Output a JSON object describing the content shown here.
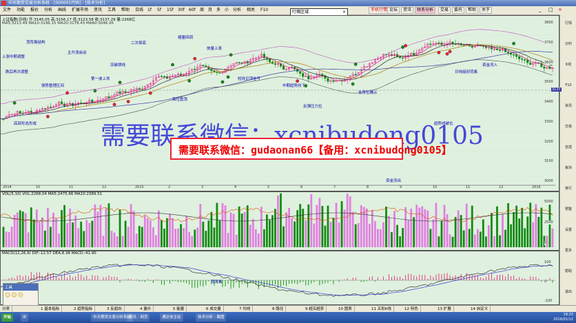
{
  "window": {
    "title": "中天期货交易分析系统 - [000001代码] - [技术分析]"
  },
  "menu": {
    "items": [
      "文件",
      "功能",
      "报价",
      "分析",
      "画线",
      "扩展市场",
      "资讯",
      "工具",
      "帮助"
    ],
    "popup": "叮嘱区域",
    "toolbar_tabs": [
      "日线",
      "1f",
      "5f",
      "15f",
      "30f",
      "60f",
      "周",
      "月",
      "多",
      "小",
      "分析",
      "相关",
      "F10"
    ],
    "right_buttons": [
      {
        "label": "手机行情",
        "red": true
      },
      {
        "label": "论坛",
        "red": false
      },
      {
        "label": "资讯",
        "red": false
      },
      {
        "label": "财务分析",
        "red": false,
        "highlight": true
      },
      {
        "label": "交易",
        "red": false
      },
      {
        "label": "委托",
        "red": false
      },
      {
        "label": "帮助",
        "red": false
      },
      {
        "label": "关于",
        "red": false
      }
    ]
  },
  "main_chart": {
    "header": "上证指数(日线) 开:3145.05 高:3156.17 低:3123.58 收:3137.29 量:2268亿",
    "header2": "MA5:3213.49 MA10:3196.15 MA20:3178.43 MA60:3046.95",
    "right_axis": [
      "3800",
      "3700",
      "3600",
      "3500",
      "3400",
      "3300",
      "3200",
      "3100",
      "3000"
    ],
    "x_labels": [
      "2014",
      "10",
      "11",
      "12",
      "2015",
      "2",
      "3",
      "4",
      "5",
      "6",
      "7",
      "8",
      "9",
      "10",
      "11",
      "12",
      "2016"
    ],
    "price_tag": "3137"
  },
  "annotations": [
    "上涨中期调整",
    "跌后再次调整",
    "顶背离结构",
    "主升浪启动",
    "强势整理区间",
    "第一波上攻",
    "二次探底",
    "突破颈线",
    "缩量回调",
    "放量上涨",
    "高位震荡",
    "短线见顶信号",
    "中期趋势向下",
    "反弹压力位",
    "支撑位确认",
    "趋势线破位",
    "日线级别背离",
    "资金流入",
    "资金流出",
    "底部形态形成"
  ],
  "volume_pane": {
    "label": "VOL(5,10) VOL:2268.04 MA5:2475.66 MA10:2389.51",
    "right_axis": [
      "5000",
      "2500",
      "0"
    ]
  },
  "macd_pane": {
    "label": "MACD(12,26,9) DIF:-12.57 DEA:8.38 MACD:-41.90",
    "right_axis": [
      "100",
      "0",
      "-100"
    ],
    "note": "顶背离"
  },
  "watermark": {
    "big": "需要联系微信：xcnibudong0105",
    "box": "需要联系微信：gudaonan66【备用：xcnibudong0105】"
  },
  "sidebar": [
    "行情",
    "分时",
    "K线",
    "F10",
    "资讯",
    "交易",
    "自选",
    "板块",
    "排行",
    "预警",
    "设置",
    "更多",
    "帮助",
    "退出"
  ],
  "tabs": [
    "分类",
    "1 基本指标",
    "2 趋势指标",
    "3 反趋向",
    "4 量价",
    "5 能量",
    "6 成交量",
    "7 均线",
    "8 路径",
    "9 超买超卖",
    "10 图表",
    "11 五彩K线",
    "12 特色",
    "13 扩展",
    "14 自定义"
  ],
  "mini_panel": {
    "title": "工具"
  },
  "taskbar": {
    "tasks": [
      "开始",
      "IE",
      "中天期货交易分析系统",
      "资讯 - 网页",
      "通达信主站",
      "技术分析 - 截图"
    ],
    "clock": "19:23",
    "date": "2016/01/12"
  },
  "colors": {
    "chart_bg": "#dff0df",
    "up": "#e0208a",
    "down": "#138a13",
    "ma": "#3a3aa0",
    "accent": "#e23"
  }
}
